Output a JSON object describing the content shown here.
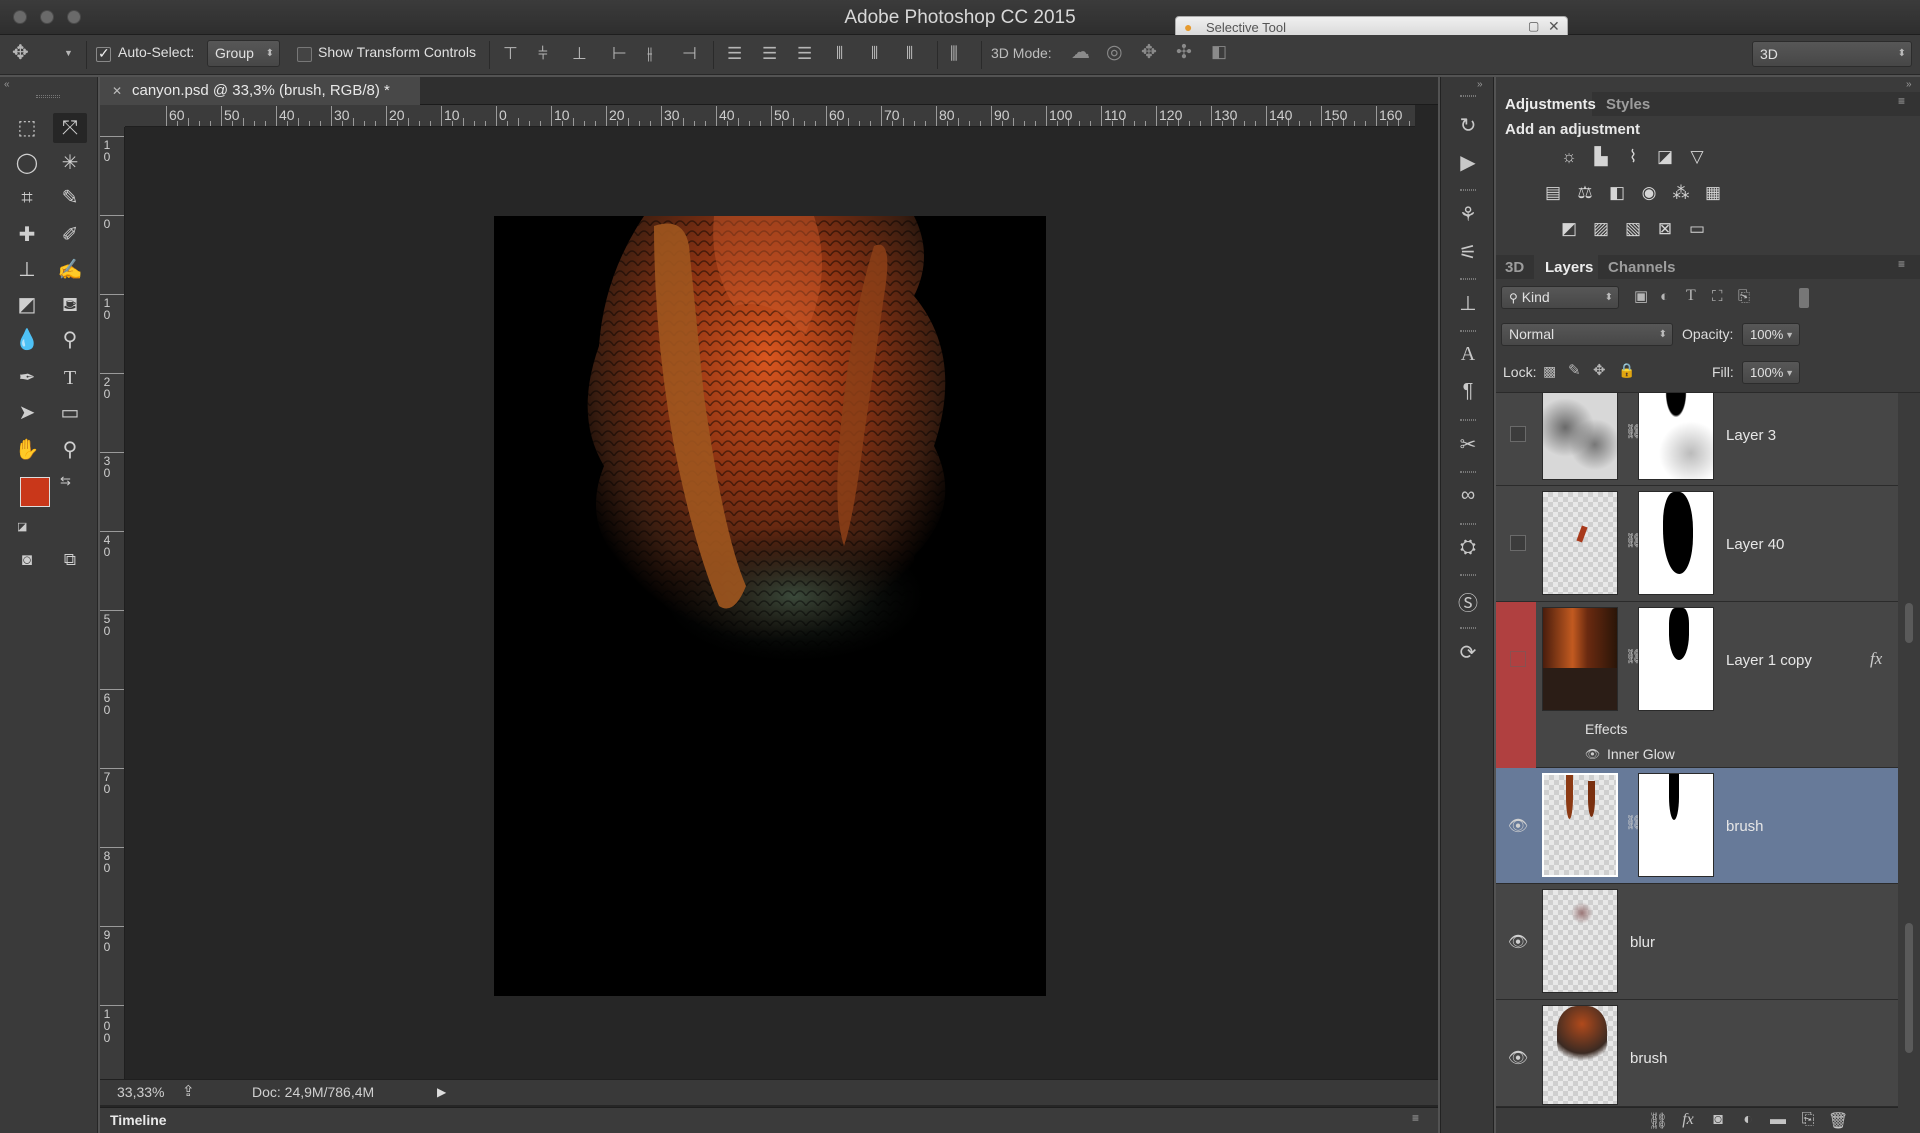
{
  "app": {
    "title": "Adobe Photoshop CC 2015",
    "floating_window_title": "Selective Tool"
  },
  "options_bar": {
    "auto_select_label": "Auto-Select:",
    "auto_select_checked": true,
    "auto_select_value": "Group",
    "show_transform_label": "Show Transform Controls",
    "show_transform_checked": false,
    "mode_3d_label": "3D Mode:",
    "workspace_value": "3D"
  },
  "colors": {
    "foreground": "#c9371a",
    "background": "#ffffff",
    "selected_layer_bg": "#677a99",
    "red_label": "#b04040"
  },
  "document": {
    "tab_label": "canyon.psd @ 33,3% (brush, RGB/8) *",
    "ruler_h_labels": [
      "60",
      "50",
      "40",
      "30",
      "20",
      "10",
      "0",
      "10",
      "20",
      "30",
      "40",
      "50",
      "60",
      "70",
      "80",
      "90",
      "100",
      "110",
      "120",
      "130",
      "140",
      "150",
      "160"
    ],
    "ruler_v_labels": [
      "1\n0",
      "0",
      "1\n0",
      "2\n0",
      "3\n0",
      "4\n0",
      "5\n0",
      "6\n0",
      "7\n0",
      "8\n0",
      "9\n0",
      "1\n0\n0"
    ],
    "zoom": "33,33%",
    "doc_info": "Doc: 24,9M/786,4M"
  },
  "timeline": {
    "label": "Timeline"
  },
  "adjustments": {
    "tabs": [
      "Adjustments",
      "Styles"
    ],
    "heading": "Add an adjustment",
    "icons": [
      "brightness-contrast-icon",
      "levels-icon",
      "curves-icon",
      "exposure-icon",
      "vibrance-icon",
      "hue-saturation-icon",
      "color-balance-icon",
      "black-white-icon",
      "photo-filter-icon",
      "channel-mixer-icon",
      "color-lookup-icon",
      "invert-icon",
      "posterize-icon",
      "threshold-icon",
      "gradient-map-icon",
      "selective-color-icon"
    ]
  },
  "layers_panel": {
    "tabs": [
      "3D",
      "Layers",
      "Channels"
    ],
    "filter_value": "Kind",
    "blend_mode": "Normal",
    "opacity_label": "Opacity:",
    "opacity_value": "100%",
    "lock_label": "Lock:",
    "fill_label": "Fill:",
    "fill_value": "100%",
    "effects_label": "Effects",
    "inner_glow_label": "Inner Glow",
    "fx_label": "fx",
    "layers": [
      {
        "name": "Layer 3",
        "visible": false
      },
      {
        "name": "Layer 40",
        "visible": false
      },
      {
        "name": "Layer 1 copy",
        "visible": false,
        "has_effects": true
      },
      {
        "name": "brush",
        "visible": true,
        "selected": true
      },
      {
        "name": "blur",
        "visible": true
      },
      {
        "name": "brush",
        "visible": true
      }
    ]
  }
}
